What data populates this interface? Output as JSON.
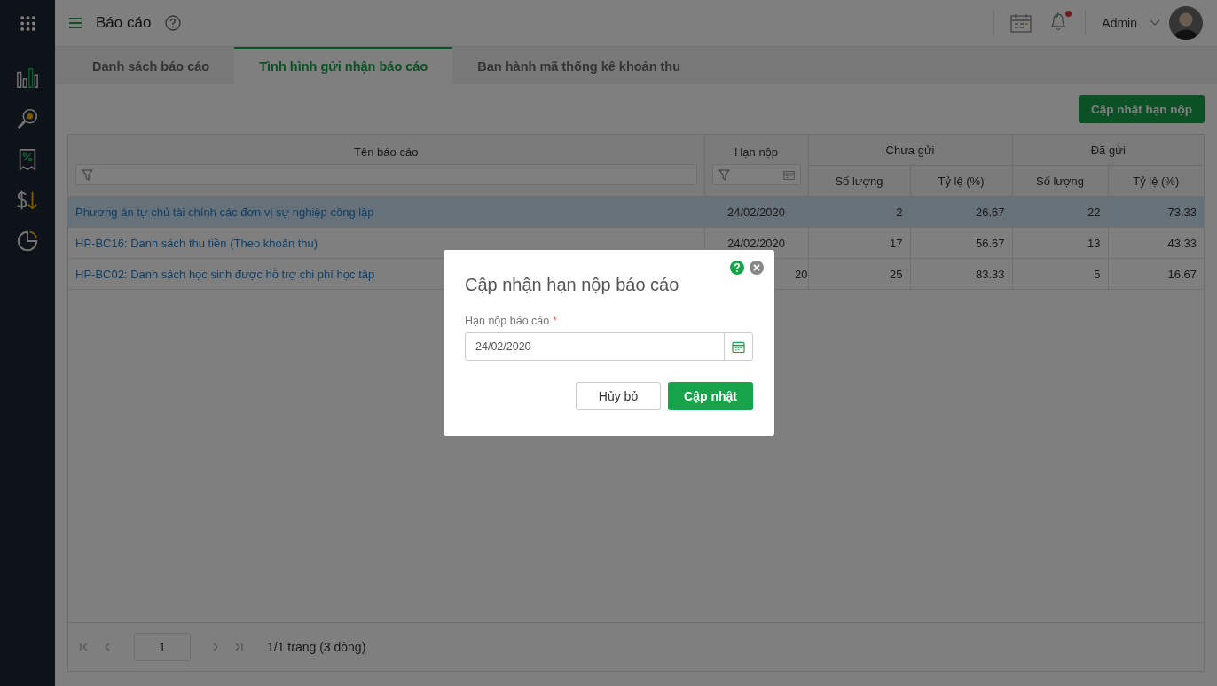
{
  "app": {
    "title": "Báo cáo",
    "user": "Admin",
    "notification_unread": true
  },
  "sidebar": {
    "items": [
      {
        "kind": "chart",
        "selected": true
      },
      {
        "kind": "search-money",
        "selected": false
      },
      {
        "kind": "receipt",
        "selected": false
      },
      {
        "kind": "money-down",
        "selected": false
      },
      {
        "kind": "pie",
        "selected": false
      }
    ]
  },
  "tabs": [
    {
      "label": "Danh sách báo cáo",
      "selected": false
    },
    {
      "label": "Tình hình gửi nhận báo cáo",
      "selected": true
    },
    {
      "label": "Ban hành mã thống kê khoản thu",
      "selected": false
    }
  ],
  "toolbar": {
    "update_button": "Cập nhật hạn nộp"
  },
  "table": {
    "name_column": "Tên báo cáo",
    "deadline_column": "Hạn nộp",
    "groups": [
      {
        "label": "Chưa gửi",
        "subcolumns": [
          "Số lượng",
          "Tỷ lệ (%)"
        ]
      },
      {
        "label": "Đã gửi",
        "subcolumns": [
          "Số lượng",
          "Tỷ lệ (%)"
        ]
      }
    ],
    "rows": [
      {
        "name": "Phương án tự chủ tài chính các đơn vị sự nghiệp công lập",
        "deadline": "24/02/2020",
        "deadline_partial": false,
        "not_sent_count": "2",
        "not_sent_ratio": "26.67",
        "sent_count": "22",
        "sent_ratio": "73.33",
        "selected": true
      },
      {
        "name": "HP-BC16: Danh sách thu tiền (Theo khoản thu)",
        "deadline": "24/02/2020",
        "deadline_partial": false,
        "not_sent_count": "17",
        "not_sent_ratio": "56.67",
        "sent_count": "13",
        "sent_ratio": "43.33",
        "selected": false
      },
      {
        "name": "HP-BC02: Danh sách học sinh được hỗ trợ chi phí học tập",
        "deadline": "20",
        "deadline_partial": true,
        "not_sent_count": "25",
        "not_sent_ratio": "83.33",
        "sent_count": "5",
        "sent_ratio": "16.67",
        "selected": false
      }
    ],
    "pagination": {
      "page": "1",
      "summary": "1/1 trang (3 dòng)"
    }
  },
  "dialog": {
    "title": "Cập nhận hạn nộp báo cáo",
    "field_label": "Hạn nộp báo cáo",
    "required": true,
    "required_mark": "*",
    "value": "24/02/2020",
    "cancel": "Hủy bỏ",
    "confirm": "Cập nhật"
  }
}
